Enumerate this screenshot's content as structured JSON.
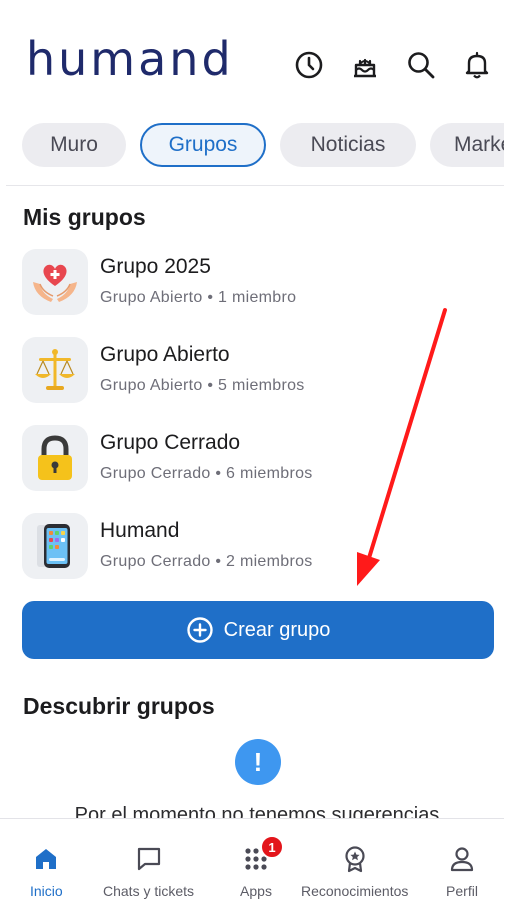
{
  "header": {
    "logo_text": "humand",
    "icons": [
      "clock-icon",
      "cake-icon",
      "search-icon",
      "bell-icon"
    ]
  },
  "tabs": [
    {
      "label": "Muro",
      "active": false
    },
    {
      "label": "Grupos",
      "active": true
    },
    {
      "label": "Noticias",
      "active": false
    },
    {
      "label": "Marketplace",
      "active": false
    }
  ],
  "my_groups": {
    "title": "Mis grupos",
    "items": [
      {
        "name": "Grupo 2025",
        "meta": "Grupo Abierto • 1 miembro",
        "icon": "heart-hands-icon"
      },
      {
        "name": "Grupo Abierto",
        "meta": "Grupo Abierto • 5 miembros",
        "icon": "scales-icon"
      },
      {
        "name": "Grupo Cerrado",
        "meta": "Grupo Cerrado • 6 miembros",
        "icon": "padlock-icon"
      },
      {
        "name": "Humand",
        "meta": "Grupo Cerrado • 2 miembros",
        "icon": "phone-icon"
      }
    ]
  },
  "create_button": {
    "label": "Crear grupo",
    "icon": "plus-circle-icon"
  },
  "discover": {
    "title": "Descubrir grupos",
    "empty_text": "Por el momento no tenemos sugerencias"
  },
  "bottom_nav": [
    {
      "label": "Inicio",
      "icon": "home-icon",
      "active": true
    },
    {
      "label": "Chats y tickets",
      "icon": "chat-icon",
      "active": false
    },
    {
      "label": "Apps",
      "icon": "apps-grid-icon",
      "active": false,
      "badge": "1"
    },
    {
      "label": "Reconocimientos",
      "icon": "award-icon",
      "active": false
    },
    {
      "label": "Perfil",
      "icon": "profile-icon",
      "active": false
    }
  ],
  "colors": {
    "brand": "#1f2a6b",
    "accent": "#1f6fc8",
    "annotation_arrow": "#ff1a1a",
    "badge": "#e3151b"
  }
}
